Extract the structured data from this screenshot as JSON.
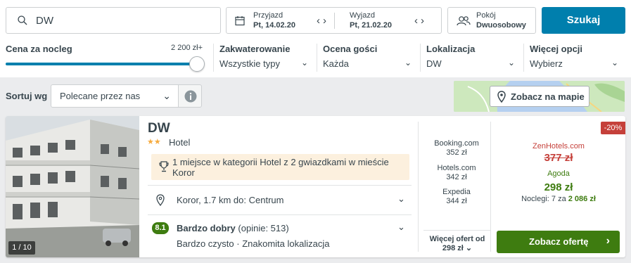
{
  "search": {
    "value": "DW"
  },
  "dates": {
    "checkin_label": "Przyjazd",
    "checkin_value": "Pt, 14.02.20",
    "checkout_label": "Wyjazd",
    "checkout_value": "Pt, 21.02.20"
  },
  "rooms": {
    "label": "Pokój",
    "value": "Dwuosobowy"
  },
  "search_button": "Szukaj",
  "filters": {
    "price_label": "Cena za nocleg",
    "price_max": "2 200 zł+",
    "price_level_percent": 100,
    "accommodation_label": "Zakwaterowanie",
    "accommodation_value": "Wszystkie typy",
    "rating_label": "Ocena gości",
    "rating_value": "Każda",
    "location_label": "Lokalizacja",
    "location_value": "DW",
    "more_label": "Więcej opcji",
    "more_value": "Wybierz"
  },
  "sort": {
    "label": "Sortuj wg",
    "value": "Polecane przez nas"
  },
  "map_button": "Zobacz na mapie",
  "hotel": {
    "photo_count": "1 / 10",
    "name": "DW",
    "stars": 2,
    "type": "Hotel",
    "award": "1 miejsce w kategorii Hotel z 2 gwiazdkami w mieście Koror",
    "location": "Koror, 1.7 km do: Centrum",
    "rating_score": "8.1",
    "rating_text": "Bardzo dobry",
    "rating_count": "(opinie: 513)",
    "rating_highlights": "Bardzo czysto · Znakomita lokalizacja"
  },
  "other_offers": [
    {
      "site": "Booking.com",
      "price": "352 zł"
    },
    {
      "site": "Hotels.com",
      "price": "342 zł"
    },
    {
      "site": "Expedia",
      "price": "344 zł"
    }
  ],
  "more_offers": {
    "line1": "Więcej ofert od",
    "line2": "298 zł"
  },
  "deal": {
    "discount": "-20%",
    "old_site": "ZenHotels.com",
    "old_price": "377 zł",
    "site": "Agoda",
    "price": "298 zł",
    "nights_prefix": "Noclegi: 7 za",
    "nights_total": "2 086 zł",
    "cta": "Zobacz ofertę"
  },
  "colors": {
    "accent_blue": "#007fad",
    "deal_green": "#3e7c10",
    "discount_red": "#c5403a",
    "award_bg": "#fcf0de"
  }
}
